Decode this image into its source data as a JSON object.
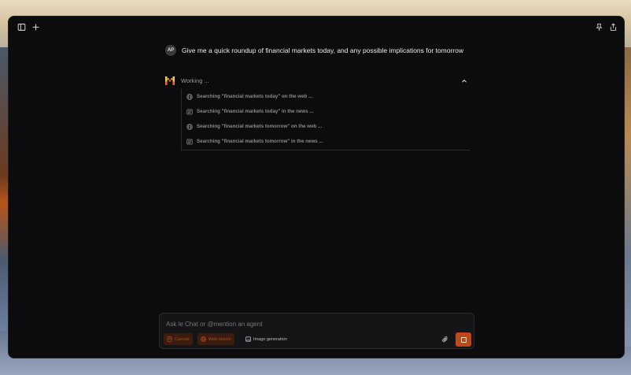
{
  "conversation": {
    "user_initials": "AP",
    "user_message": "Give me a quick roundup of financial markets today, and any possible implications for tomorrow",
    "status_label": "Working ...",
    "steps": [
      {
        "icon": "globe-icon",
        "text": "Searching \"financial markets today\" on the web ..."
      },
      {
        "icon": "news-icon",
        "text": "Searching \"financial markets today\" in the news ..."
      },
      {
        "icon": "globe-icon",
        "text": "Searching \"financial markets tomorrow\" on the web ..."
      },
      {
        "icon": "news-icon",
        "text": "Searching \"financial markets tomorrow\" in the news ..."
      }
    ]
  },
  "composer": {
    "placeholder": "Ask le Chat or @mention an agent",
    "tools": [
      {
        "label": "Canvas",
        "active": true,
        "icon": "canvas-icon"
      },
      {
        "label": "Web search",
        "active": true,
        "icon": "globe-icon"
      },
      {
        "label": "Image generation",
        "active": false,
        "icon": "image-icon"
      }
    ]
  },
  "colors": {
    "accent": "#c1461a",
    "background": "#0c0c0e"
  }
}
